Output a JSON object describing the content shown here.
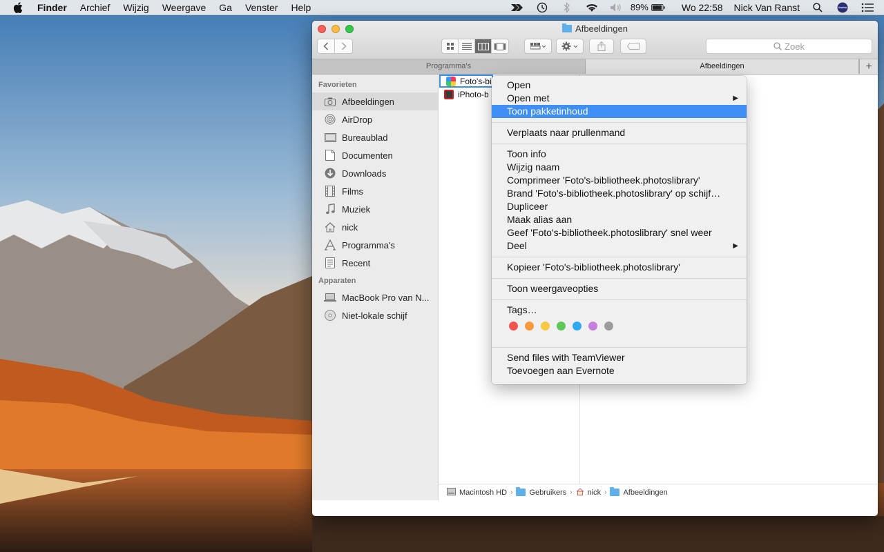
{
  "menubar": {
    "items": [
      "Finder",
      "Archief",
      "Wijzig",
      "Weergave",
      "Ga",
      "Venster",
      "Help"
    ],
    "battery": "89%",
    "clock": "Wo 22:58",
    "user": "Nick Van Ranst"
  },
  "window": {
    "title": "Afbeeldingen",
    "search_placeholder": "Zoek",
    "tabs": [
      "Programma's",
      "Afbeeldingen"
    ],
    "tab_plus": "+"
  },
  "sidebar": {
    "favorites_heading": "Favorieten",
    "favorites": [
      {
        "label": "Afbeeldingen",
        "icon": "camera-icon",
        "selected": true
      },
      {
        "label": "AirDrop",
        "icon": "airdrop-icon"
      },
      {
        "label": "Bureaublad",
        "icon": "desktop-icon"
      },
      {
        "label": "Documenten",
        "icon": "document-icon"
      },
      {
        "label": "Downloads",
        "icon": "download-icon"
      },
      {
        "label": "Films",
        "icon": "film-icon"
      },
      {
        "label": "Muziek",
        "icon": "music-icon"
      },
      {
        "label": "nick",
        "icon": "home-icon"
      },
      {
        "label": "Programma's",
        "icon": "apps-icon"
      },
      {
        "label": "Recent",
        "icon": "recent-icon"
      }
    ],
    "devices_heading": "Apparaten",
    "devices": [
      {
        "label": "MacBook Pro van N...",
        "icon": "laptop-icon"
      },
      {
        "label": "Niet-lokale schijf",
        "icon": "disc-icon"
      }
    ]
  },
  "files": [
    {
      "label": "Foto's-bi",
      "selected": true
    },
    {
      "label": "iPhoto-b"
    }
  ],
  "pathbar": [
    "Macintosh HD",
    "Gebruikers",
    "nick",
    "Afbeeldingen"
  ],
  "context_menu": {
    "group1": [
      "Open",
      "Open met",
      "Toon pakketinhoud"
    ],
    "group2": [
      "Verplaats naar prullenmand"
    ],
    "group3": [
      "Toon info",
      "Wijzig naam",
      "Comprimeer 'Foto's-bibliotheek.photoslibrary'",
      "Brand 'Foto's-bibliotheek.photoslibrary' op schijf…",
      "Dupliceer",
      "Maak alias aan",
      "Geef 'Foto's-bibliotheek.photoslibrary' snel weer",
      "Deel"
    ],
    "group4": [
      "Kopieer 'Foto's-bibliotheek.photoslibrary'"
    ],
    "group5": [
      "Toon weergaveopties"
    ],
    "tags_label": "Tags…",
    "tag_colors": [
      "#f25450",
      "#f79a3c",
      "#f7c842",
      "#5dc855",
      "#2eaaf3",
      "#c67fdd",
      "#9c9c9c"
    ],
    "group7": [
      "Send files with TeamViewer",
      "Toevoegen aan Evernote"
    ],
    "highlight_color": "#3f8ff5"
  }
}
